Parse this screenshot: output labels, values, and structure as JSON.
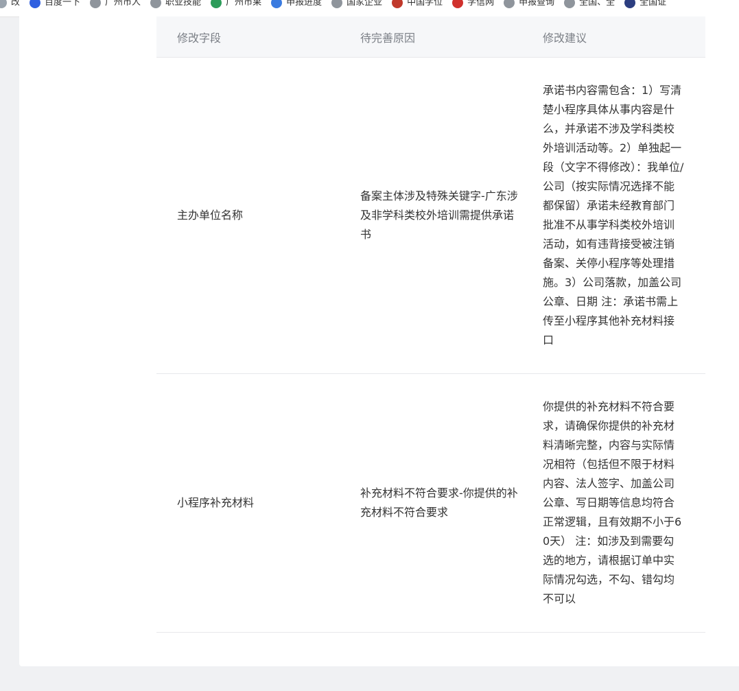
{
  "bookmarks": [
    {
      "label": "改",
      "icon": "bookmark-icon",
      "color": "#9aa3ad"
    },
    {
      "label": "百度一下",
      "icon": "baidu-paw-icon",
      "color": "#2f5fe0"
    },
    {
      "label": "广州市人",
      "icon": "globe-icon",
      "color": "#8f959c"
    },
    {
      "label": "职业技能",
      "icon": "globe-icon",
      "color": "#8f959c"
    },
    {
      "label": "广州市果",
      "icon": "gov-emblem-icon",
      "color": "#2d9c5a"
    },
    {
      "label": "申报进度",
      "icon": "snowflake-icon",
      "color": "#3a7be0"
    },
    {
      "label": "国家企业",
      "icon": "globe-icon",
      "color": "#8f959c"
    },
    {
      "label": "中国学位",
      "icon": "book-icon",
      "color": "#c0392b"
    },
    {
      "label": "学信网",
      "icon": "chsi-icon",
      "color": "#d0312d"
    },
    {
      "label": "申报查询",
      "icon": "globe-icon",
      "color": "#8f959c"
    },
    {
      "label": "全国、全",
      "icon": "globe-icon",
      "color": "#8f959c"
    },
    {
      "label": "全国证",
      "icon": "seal-icon",
      "color": "#2c3e80"
    }
  ],
  "table": {
    "headers": [
      "修改字段",
      "待完善原因",
      "修改建议"
    ],
    "rows": [
      {
        "field": "主办单位名称",
        "reason": "备案主体涉及特殊关键字-广东涉及非学科类校外培训需提供承诺书",
        "suggestion": "承诺书内容需包含：1）写清楚小程序具体从事内容是什么，并承诺不涉及学科类校外培训活动等。2）单独起一段（文字不得修改）：我单位/公司（按实际情况选择不能都保留）承诺未经教育部门批准不从事学科类校外培训活动，如有违背接受被注销备案、关停小程序等处理措施。3）公司落款，加盖公司公章、日期 注：承诺书需上传至小程序其他补充材料接口"
      },
      {
        "field": "小程序补充材料",
        "reason": "补充材料不符合要求-你提供的补充材料不符合要求",
        "suggestion": "你提供的补充材料不符合要求，请确保你提供的补充材料清晰完整，内容与实际情况相符（包括但不限于材料内容、法人签字、加盖公司公章、写日期等信息均符合正常逻辑，且有效期不小于60天） 注：如涉及到需要勾选的地方，请根据订单中实际情况勾选，不勾、错勾均不可以"
      }
    ]
  }
}
